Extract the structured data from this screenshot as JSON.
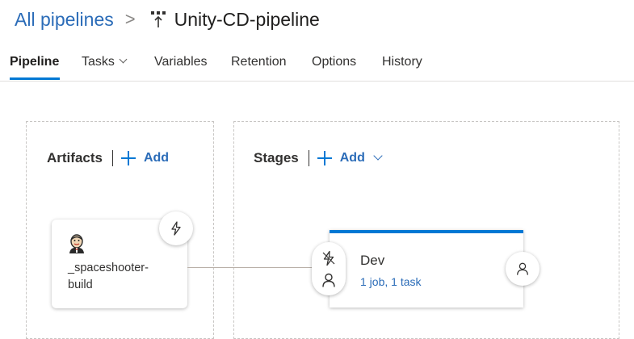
{
  "breadcrumb": {
    "root": "All pipelines",
    "separator": ">",
    "pipeline_icon": "release-pipeline-icon",
    "title": "Unity-CD-pipeline"
  },
  "tabs": [
    {
      "label": "Pipeline",
      "active": true
    },
    {
      "label": "Tasks",
      "has_dropdown": true
    },
    {
      "label": "Variables"
    },
    {
      "label": "Retention"
    },
    {
      "label": "Options"
    },
    {
      "label": "History"
    }
  ],
  "artifacts": {
    "title": "Artifacts",
    "add_label": "Add",
    "items": [
      {
        "name": "_spaceshooter-build",
        "icon": "jenkins-icon",
        "trigger_icon": "lightning-icon"
      }
    ]
  },
  "stages": {
    "title": "Stages",
    "add_label": "Add",
    "add_has_dropdown": true,
    "items": [
      {
        "name": "Dev",
        "detail": "1 job, 1 task",
        "pre_icons": [
          "lightning-icon",
          "person-icon"
        ],
        "post_icon": "person-icon"
      }
    ]
  },
  "colors": {
    "accent": "#0078d4",
    "link": "#2b6cb8",
    "text": "#323130",
    "border": "#c8c6c4"
  }
}
